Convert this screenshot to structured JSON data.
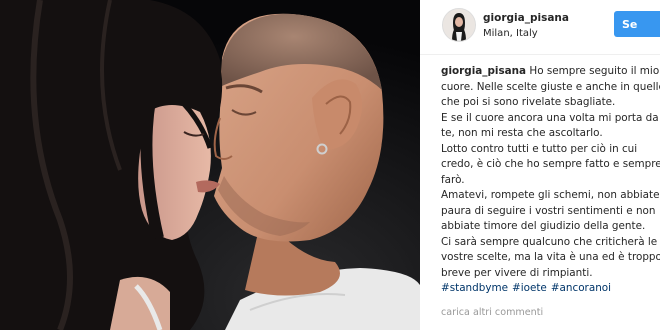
{
  "post": {
    "username": "giorgia_pisana",
    "location": "Milan, Italy",
    "follow_label": "Se",
    "caption_lines": [
      "Ho sempre seguito il mio",
      "cuore. Nelle scelte giuste e anche in quelle",
      "che poi si sono rivelate sbagliate.",
      "E se il cuore ancora una volta mi porta da",
      "te, non mi resta che ascoltarlo.",
      "Lotto contro tutti e tutto per ciò in cui",
      "credo, è ciò che ho sempre fatto e sempre",
      "farò.",
      "Amatevi, rompete gli schemi, non abbiate",
      "paura di seguire i vostri sentimenti e non",
      "abbiate timore del giudizio della gente.",
      "Ci sarà sempre qualcuno che criticherà le",
      "vostre scelte, ma la vita è una ed è troppo",
      "breve per vivere di rimpianti."
    ],
    "hashtags": [
      "#standbyme",
      "#ioete",
      "#ancoranoi"
    ],
    "load_more_label": "carica altri commenti"
  },
  "icons": {
    "avatar": "profile-avatar",
    "photo": "couple-kissing-photo"
  }
}
